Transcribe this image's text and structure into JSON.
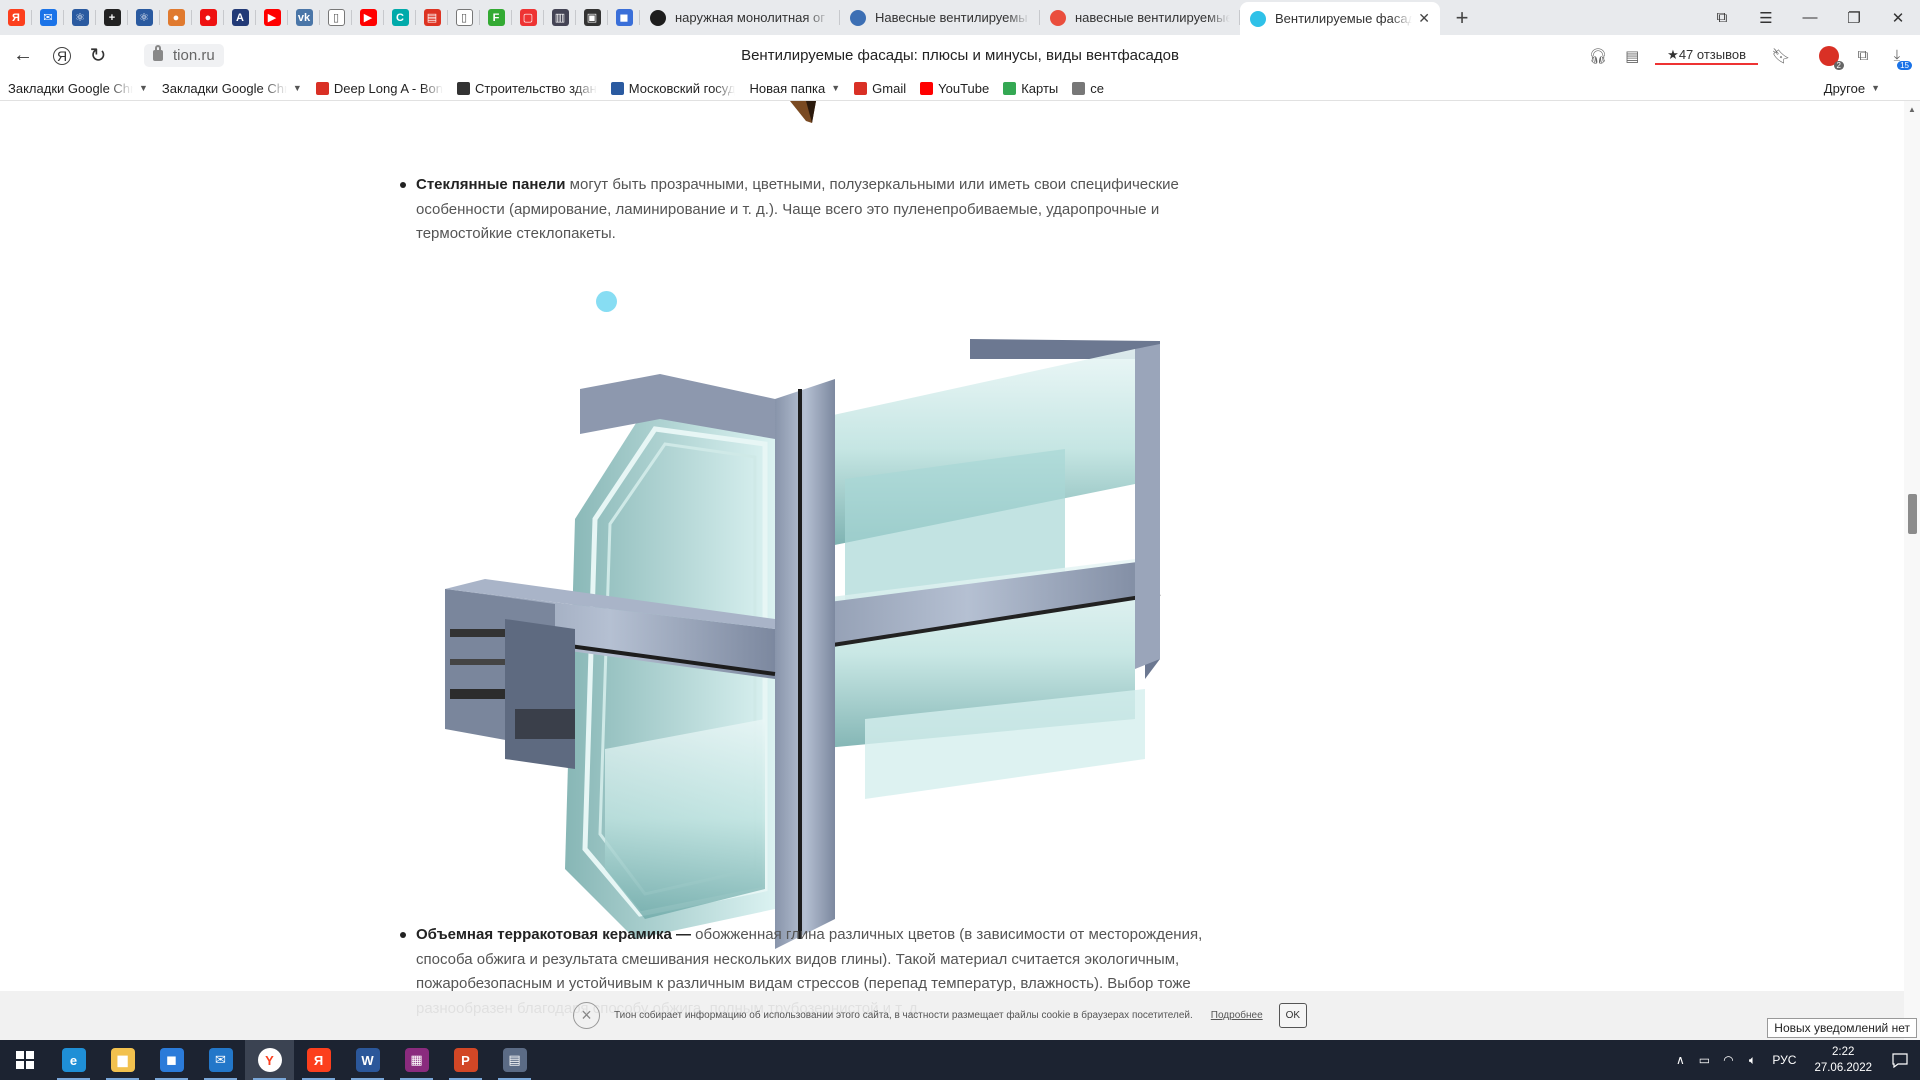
{
  "browser": {
    "tabs": [
      {
        "title": "наружная монолитная ог",
        "icon_color": "#1d1d1d"
      },
      {
        "title": "Навесные вентилируемы",
        "icon_color": "#3c6fb4"
      },
      {
        "title": "навесные вентилируемые",
        "icon_color": "#ea4e3d"
      },
      {
        "title": "Вентилируемые фасады",
        "icon_color": "#2fc1e8",
        "active": true
      }
    ],
    "pinned_icons": [
      "yandex-icon",
      "mail-icon",
      "atom-icon",
      "plus-icon",
      "atom-icon",
      "avatar-icon",
      "record-icon",
      "ai-icon",
      "youtube-icon",
      "vk-icon",
      "doc-icon",
      "youtube-icon",
      "c-icon",
      "pdf-icon",
      "doc-icon",
      "f-icon",
      "note-icon",
      "bank-icon",
      "save-icon",
      "app-icon"
    ],
    "new_tab": "+",
    "window_controls": {
      "minimize": "—",
      "restore": "❐",
      "close": "✕"
    }
  },
  "addressbar": {
    "back": "←",
    "home": "Я",
    "reload": "↻",
    "url": "tion.ru",
    "page_title": "Вентилируемые фасады: плюсы и минусы, виды вентфасадов",
    "reviews": "★47 отзывов",
    "download_badge": "15",
    "ext_badge": "2"
  },
  "bookmarks": {
    "items": [
      {
        "label": "Закладки Google Chrome",
        "folder": true,
        "color": ""
      },
      {
        "label": "Закладки Google Chrome",
        "folder": true,
        "color": ""
      },
      {
        "label": "Deep Long A - Bon",
        "color": "#d93025"
      },
      {
        "label": "Строительство здан",
        "color": "#333333"
      },
      {
        "label": "Московский госуд",
        "color": "#2a5aa0"
      },
      {
        "label": "Новая папка",
        "folder": true,
        "color": ""
      },
      {
        "label": "Gmail",
        "color": "#d93025"
      },
      {
        "label": "YouTube",
        "color": "#ff0000"
      },
      {
        "label": "Карты",
        "color": "#34a853"
      },
      {
        "label": "се",
        "color": "#777777"
      }
    ],
    "other": "Другое"
  },
  "article": {
    "para1_bold": "Стеклянные панели",
    "para1_text": " могут быть прозрачными, цветными, полузеркальными или иметь свои специфические особенности (армирование, ламинирование и т. д.). Чаще всего это пуленепробиваемые, ударопрочные и термостойкие стеклопакеты.",
    "para2_bold": "Объемная терракотовая керамика —",
    "para2_text": " обожженная глина различных цветов (в зависимости от месторождения, способа обжига и результата смешивания нескольких видов глины). Такой материал считается экологичным, пожаробезопасным и устойчивым к различным видам стрессов (перепад температур, влажность). Выбор тоже разнообразен благодаря способу обжига, полным трубозернистой и т. д."
  },
  "cookie": {
    "message": "Тион собирает информацию об использовании этого сайта, в частности размещает файлы cookie в браузерах посетителей.",
    "more": "Подробнее",
    "ok": "OK"
  },
  "notification_tooltip": "Новых уведомлений нет",
  "taskbar": {
    "apps": [
      {
        "name": "edge",
        "color": "#1f8fd6",
        "glyph": "e"
      },
      {
        "name": "explorer",
        "color": "#f2c14e",
        "glyph": "▆"
      },
      {
        "name": "store",
        "color": "#2b7bd9",
        "glyph": "◼"
      },
      {
        "name": "mail",
        "color": "#2377c9",
        "glyph": "✉"
      },
      {
        "name": "yandex-browser",
        "color": "#ffffff",
        "glyph": "Y",
        "active": true
      },
      {
        "name": "yandex",
        "color": "#fc3f1d",
        "glyph": "Я"
      },
      {
        "name": "word",
        "color": "#2b579a",
        "glyph": "W"
      },
      {
        "name": "winrar",
        "color": "#8a2b7e",
        "glyph": "▦"
      },
      {
        "name": "powerpoint",
        "color": "#d24726",
        "glyph": "P"
      },
      {
        "name": "calculator",
        "color": "#5b6b85",
        "glyph": "▤"
      }
    ],
    "tray": {
      "lang": "РУС",
      "time": "2:22",
      "date": "27.06.2022"
    }
  }
}
